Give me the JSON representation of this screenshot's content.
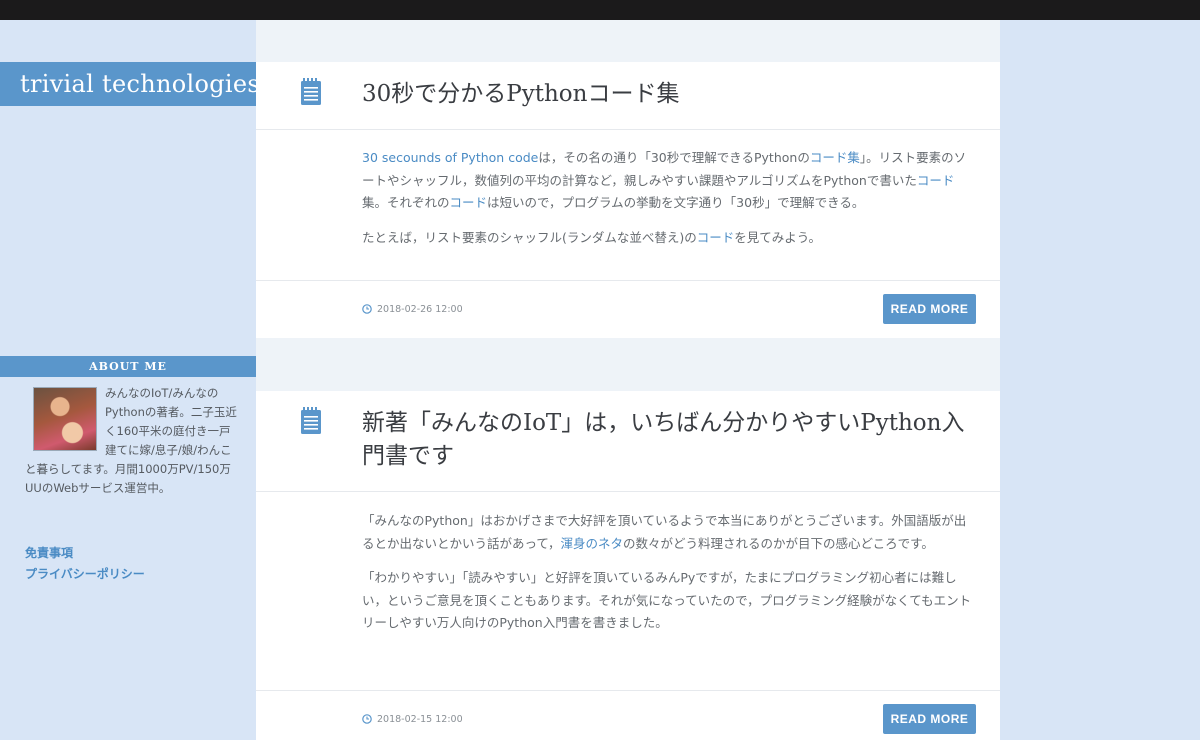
{
  "site": {
    "title": "trivial technologies"
  },
  "about": {
    "heading": "ABOUT ME",
    "bio": "みんなのIoT/みんなのPythonの著者。二子玉近く160平米の庭付き一戸建てに嫁/息子/娘/わんこと暮らしてます。月間1000万PV/150万UUのWebサービス運営中。",
    "links": [
      {
        "label": "免責事項"
      },
      {
        "label": "プライバシーポリシー"
      }
    ]
  },
  "colors": {
    "accent": "#5a96cb",
    "link": "#4a8bc4",
    "topbar": "#1b1a1b",
    "page_bg": "#d8e5f6"
  },
  "posts": [
    {
      "title": "30秒で分かるPythonコード集",
      "icon": "notepad-icon",
      "paragraphs": [
        [
          {
            "text": "30 secounds of Python code",
            "link": true
          },
          {
            "text": "は，その名の通り「30秒で理解できるPythonの",
            "link": false
          },
          {
            "text": "コード集",
            "link": true
          },
          {
            "text": "」。リスト要素のソートやシャッフル，数値列の平均の計算など，親しみやすい課題やアルゴリズムをPythonで書いた",
            "link": false
          },
          {
            "text": "コード",
            "link": true
          },
          {
            "text": "集。それぞれの",
            "link": false
          },
          {
            "text": "コード",
            "link": true
          },
          {
            "text": "は短いので，プログラムの挙動を文字通り「30秒」で理解できる。",
            "link": false
          }
        ],
        [
          {
            "text": "たとえば，リスト要素のシャッフル(ランダムな並べ替え)の",
            "link": false
          },
          {
            "text": "コード",
            "link": true
          },
          {
            "text": "を見てみよう。",
            "link": false
          }
        ]
      ],
      "date": "2018-02-26 12:00",
      "read_more": "READ MORE"
    },
    {
      "title": "新著「みんなのIoT」は，いちばん分かりやすいPython入門書です",
      "icon": "notepad-icon",
      "paragraphs": [
        [
          {
            "text": "「みんなのPython」はおかげさまで大好評を頂いているようで本当にありがとうございます。外国語版が出るとか出ないとかいう話があって，",
            "link": false
          },
          {
            "text": "渾身のネタ",
            "link": true
          },
          {
            "text": "の数々がどう料理されるのかが目下の感心どころです。",
            "link": false
          }
        ],
        [
          {
            "text": "「わかりやすい」「読みやすい」と好評を頂いているみんPyですが，たまにプログラミング初心者には難しい，というご意見を頂くこともあります。それが気になっていたので，プログラミング経験がなくてもエントリーしやすい万人向けのPython入門書を書きました。",
            "link": false
          }
        ]
      ],
      "date": "2018-02-15 12:00",
      "read_more": "READ MORE"
    }
  ]
}
